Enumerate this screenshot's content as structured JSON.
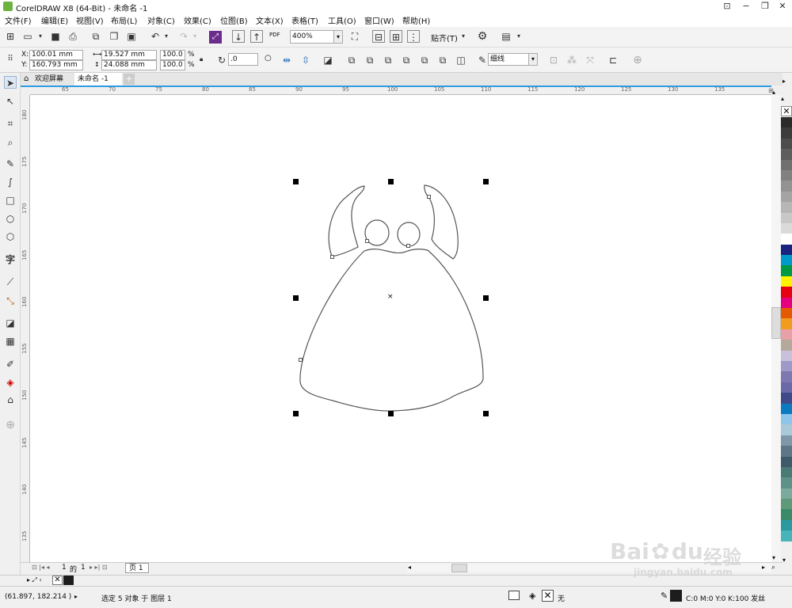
{
  "app": {
    "title": "CorelDRAW X8 (64-Bit) - 未命名 -1",
    "window_controls": [
      "⊡",
      "−",
      "❐",
      "✕"
    ]
  },
  "menu": [
    "文件(F)",
    "编辑(E)",
    "视图(V)",
    "布局(L)",
    "对象(C)",
    "效果(C)",
    "位图(B)",
    "文本(X)",
    "表格(T)",
    "工具(O)",
    "窗口(W)",
    "帮助(H)"
  ],
  "toolbar": {
    "zoom_value": "400%",
    "snap_label": "贴齐(T)",
    "pdf_label": "PDF"
  },
  "property_bar": {
    "x_label": "X:",
    "x_value": "100.01 mm",
    "y_label": "Y:",
    "y_value": "160.793 mm",
    "width_value": "19.527 mm",
    "height_value": "24.088 mm",
    "scale_x": "100.0",
    "scale_y": "100.0",
    "pct1": "%",
    "pct2": "%",
    "rotation": ".0",
    "outline_width": "细线"
  },
  "tabs": [
    {
      "label": "欢迎屏幕"
    },
    {
      "label": "未命名 -1"
    }
  ],
  "rulers": {
    "h_labels": [
      "65",
      "70",
      "75",
      "80",
      "85",
      "90",
      "95",
      "100",
      "105",
      "110",
      "115",
      "120",
      "125",
      "130",
      "135"
    ],
    "v_labels": [
      "180",
      "175",
      "170",
      "165",
      "160",
      "155",
      "150",
      "145",
      "140",
      "135"
    ]
  },
  "page_nav": {
    "current": "1",
    "of": "的",
    "total": "1",
    "page_tab": "页 1"
  },
  "status": {
    "coordinates": "(61.897, 182.214 )",
    "selection": "选定 5 对象 于 图层 1",
    "fill_none": "无",
    "color_info": "C:0 M:0 Y:0 K:100  发丝"
  },
  "palette_colors": [
    "#2b2b2b",
    "#3c3c3c",
    "#4d4d4d",
    "#5e5e5e",
    "#707070",
    "#818181",
    "#939393",
    "#a4a4a4",
    "#b6b6b6",
    "#c8c8c8",
    "#dadada",
    "#ffffff",
    "#1a237e",
    "#0099cc",
    "#009944",
    "#fff200",
    "#e60012",
    "#e4007f",
    "#e55a00",
    "#f29c1f",
    "#e8a0a8",
    "#b5a99c",
    "#c9c1db",
    "#9e9ac8",
    "#7d78b0",
    "#6a6aa8",
    "#3f4a8a",
    "#0b7bc1",
    "#8ec5e8",
    "#a9c8d8",
    "#7f97a8",
    "#5d7787",
    "#3f5a68",
    "#4a7a74",
    "#5d9288",
    "#7aab9c",
    "#5e9a7a",
    "#3b8a6a",
    "#2a9aa0",
    "#48b3b8"
  ],
  "watermark": {
    "brand": "Bai",
    "brand2": "du",
    "product": "经验",
    "url": "jingyan.baidu.com"
  }
}
